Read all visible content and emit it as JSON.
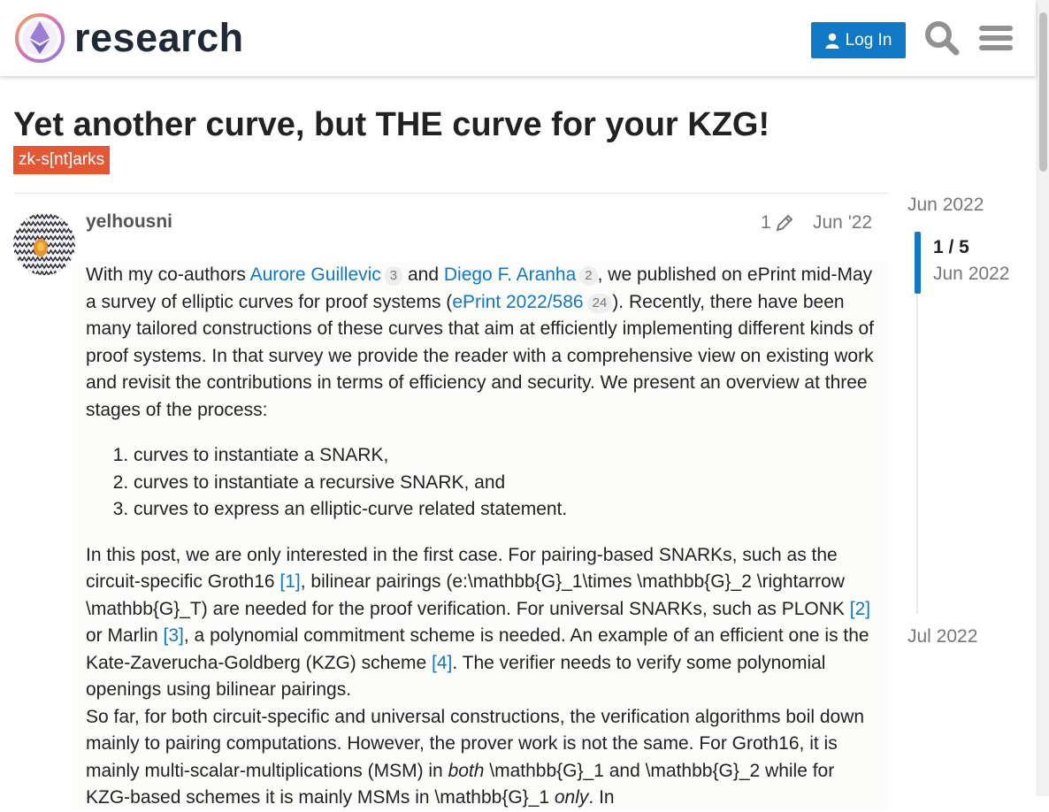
{
  "header": {
    "logo_text": "research",
    "login_label": "Log In"
  },
  "topic": {
    "title": "Yet another curve, but THE curve for your KZG!",
    "category": "zk-s[nt]arks",
    "category_color": "#e45735"
  },
  "post": {
    "username": "yelhousni",
    "edit_count": "1",
    "date": "Jun '22",
    "p1_a": "With my co-authors ",
    "author1": "Aurore Guillevic",
    "author1_clicks": "3",
    "p1_b": " and ",
    "author2": "Diego F. Aranha",
    "author2_clicks": "2",
    "p1_c": ", we published on ePrint mid-May a survey of elliptic curves for proof systems (",
    "eprint_link": "ePrint 2022/586",
    "eprint_clicks": "24",
    "p1_d": "). Recently, there have been many tailored constructions of these curves that aim at efficiently implementing different kinds of proof systems. In that survey we provide the reader with a comprehensive view on existing work and revisit the contributions in terms of efficiency and security. We present an overview at three stages of the process:",
    "list": [
      "curves to instantiate a SNARK,",
      "curves to instantiate a recursive SNARK, and",
      "curves to express an elliptic-curve related statement."
    ],
    "p2_a": "In this post, we are only interested in the first case. For pairing-based SNARKs, such as the circuit-specific Groth16 ",
    "ref1": "[1]",
    "p2_b": ", bilinear pairings (e:\\mathbb{G}_1\\times \\mathbb{G}_2 \\rightarrow \\mathbb{G}_T) are needed for the proof verification. For universal SNARKs, such as PLONK ",
    "ref2": "[2]",
    "p2_c": " or Marlin ",
    "ref3": "[3]",
    "p2_d": ", a polynomial commitment scheme is needed. An example of an efficient one is the Kate-Zaverucha-Goldberg (KZG) scheme ",
    "ref4": "[4]",
    "p2_e": ". The verifier needs to verify some polynomial openings using bilinear pairings.",
    "p3_a": "So far, for both circuit-specific and universal constructions, the verification algorithms boil down mainly to pairing computations. However, the prover work is not the same. For Groth16, it is mainly multi-scalar-multiplications (MSM) in ",
    "p3_both": "both",
    "p3_b": " \\mathbb{G}_1 and \\mathbb{G}_2 while for KZG-based schemes it is mainly MSMs in \\mathbb{G}_1 ",
    "p3_only": "only",
    "p3_c": ". In"
  },
  "timeline": {
    "start": "Jun 2022",
    "position": "1 / 5",
    "current_date": "Jun 2022",
    "end": "Jul 2022"
  }
}
